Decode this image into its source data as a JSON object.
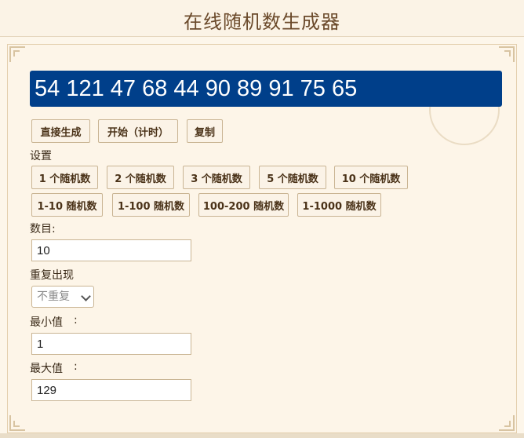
{
  "header": {
    "title": "在线随机数生成器"
  },
  "result": {
    "numbers": "54 121 47 68 44 90 89 91 75 65"
  },
  "actions": {
    "generate": "直接生成",
    "start_timed": "开始（计时）",
    "copy": "复制"
  },
  "settings": {
    "label": "设置",
    "count_presets": [
      "1 个随机数",
      "2 个随机数",
      "3 个随机数",
      "5 个随机数",
      "10 个随机数"
    ],
    "range_presets": [
      "1-10 随机数",
      "1-100 随机数",
      "100-200 随机数",
      "1-1000 随机数"
    ]
  },
  "count": {
    "label": "数目:",
    "value": "10"
  },
  "repeat": {
    "label": "重复出现",
    "selected": "不重复"
  },
  "min": {
    "label": "最小值",
    "colon": ":",
    "value": "1"
  },
  "max": {
    "label": "最大值",
    "colon": ":",
    "value": "129"
  },
  "colors": {
    "result_bg": "#003f8a",
    "page_bg": "#fdf6ea",
    "accent_text": "#6b4a2b"
  }
}
